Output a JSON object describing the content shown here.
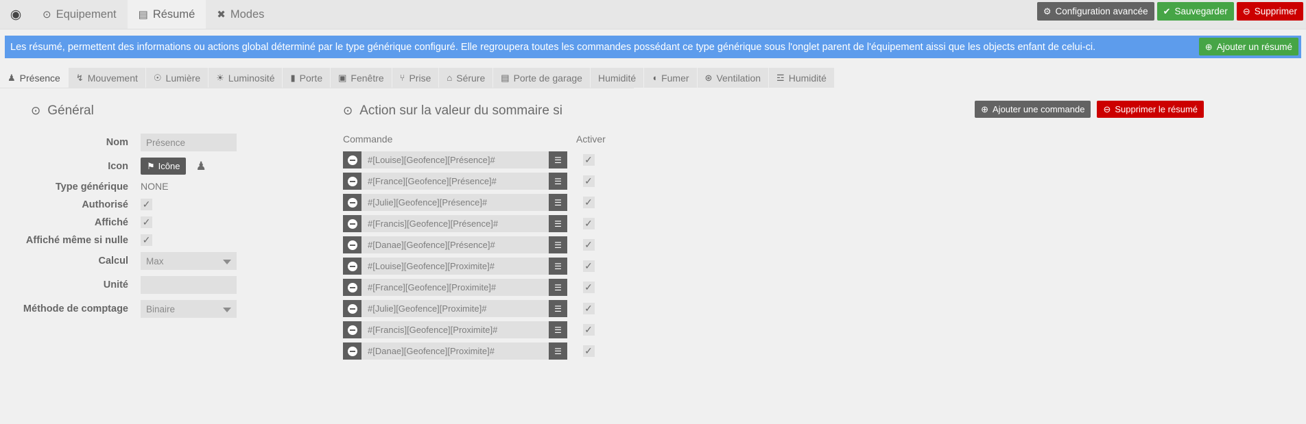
{
  "topbar": {
    "back_icon": "◀",
    "tabs": [
      {
        "label": "Equipement",
        "icon": "⊙",
        "active": false
      },
      {
        "label": "Résumé",
        "icon": "▤",
        "active": true
      },
      {
        "label": "Modes",
        "icon": "✖",
        "active": false
      }
    ],
    "actions": [
      {
        "label": "Configuration avancée",
        "icon": "⚙",
        "style": "grey"
      },
      {
        "label": "Sauvegarder",
        "icon": "✔",
        "style": "green"
      },
      {
        "label": "Supprimer",
        "icon": "⊖",
        "style": "red"
      }
    ]
  },
  "alert": {
    "text": "Les résumé, permettent des informations ou actions global déterminé par le type générique configuré. Elle regroupera toutes les commandes possédant ce type générique sous l'onglet parent de l'équipement aissi que les objects enfant de celui-ci.",
    "add_button": "Ajouter un résumé",
    "add_icon": "⊕",
    "color": "#5d9cec"
  },
  "tabstrip": [
    {
      "label": "Présence",
      "icon": "♟",
      "active": true
    },
    {
      "label": "Mouvement",
      "icon": "↯",
      "active": false
    },
    {
      "label": "Lumière",
      "icon": "☉",
      "active": false
    },
    {
      "label": "Luminosité",
      "icon": "☀",
      "active": false
    },
    {
      "label": "Porte",
      "icon": "▮",
      "active": false
    },
    {
      "label": "Fenêtre",
      "icon": "▣",
      "active": false
    },
    {
      "label": "Prise",
      "icon": "⑂",
      "active": false
    },
    {
      "label": "Sérure",
      "icon": "⌂",
      "active": false
    },
    {
      "label": "Porte de garage",
      "icon": "▤",
      "active": false
    },
    {
      "label": "Humidité",
      "icon": "",
      "active": false
    },
    {
      "label": "Fumer",
      "icon": "◖",
      "active": false
    },
    {
      "label": "Ventilation",
      "icon": "⊛",
      "active": false
    },
    {
      "label": "Humidité",
      "icon": "☲",
      "active": false
    }
  ],
  "general": {
    "title": "Général",
    "title_icon": "⊙",
    "nom_label": "Nom",
    "nom_value": "Présence",
    "nom_placeholder": "Présence",
    "icon_label": "Icon",
    "icon_button": "Icône",
    "icon_button_glyph": "⚑",
    "icon_preview": "♟",
    "type_label": "Type générique",
    "type_value": "NONE",
    "authorise_label": "Authorisé",
    "authorise_checked": "✓",
    "affiche_label": "Affiché",
    "affiche_checked": "✓",
    "affiche_nulle_label": "Affiché même si nulle",
    "affiche_nulle_checked": "✓",
    "calcul_label": "Calcul",
    "calcul_value": "Max",
    "unite_label": "Unité",
    "unite_value": "",
    "methode_label": "Méthode de comptage",
    "methode_value": "Binaire"
  },
  "action_panel": {
    "title": "Action sur la valeur du sommaire si",
    "title_icon": "⊙",
    "col_commande": "Commande",
    "col_activer": "Activer",
    "add_command_button": "Ajouter une commande",
    "add_command_icon": "⊕",
    "delete_summary_button": "Supprimer le résumé",
    "delete_summary_icon": "⊖",
    "list_icon": "☰",
    "check_glyph": "✓",
    "rows": [
      {
        "command": "#[Louise][Geofence][Présence]#",
        "enabled": true
      },
      {
        "command": "#[France][Geofence][Présence]#",
        "enabled": true
      },
      {
        "command": "#[Julie][Geofence][Présence]#",
        "enabled": true
      },
      {
        "command": "#[Francis][Geofence][Présence]#",
        "enabled": true
      },
      {
        "command": "#[Danae][Geofence][Présence]#",
        "enabled": true
      },
      {
        "command": "#[Louise][Geofence][Proximite]#",
        "enabled": true
      },
      {
        "command": "#[France][Geofence][Proximite]#",
        "enabled": true
      },
      {
        "command": "#[Julie][Geofence][Proximite]#",
        "enabled": true
      },
      {
        "command": "#[Francis][Geofence][Proximite]#",
        "enabled": true
      },
      {
        "command": "#[Danae][Geofence][Proximite]#",
        "enabled": true
      }
    ]
  }
}
